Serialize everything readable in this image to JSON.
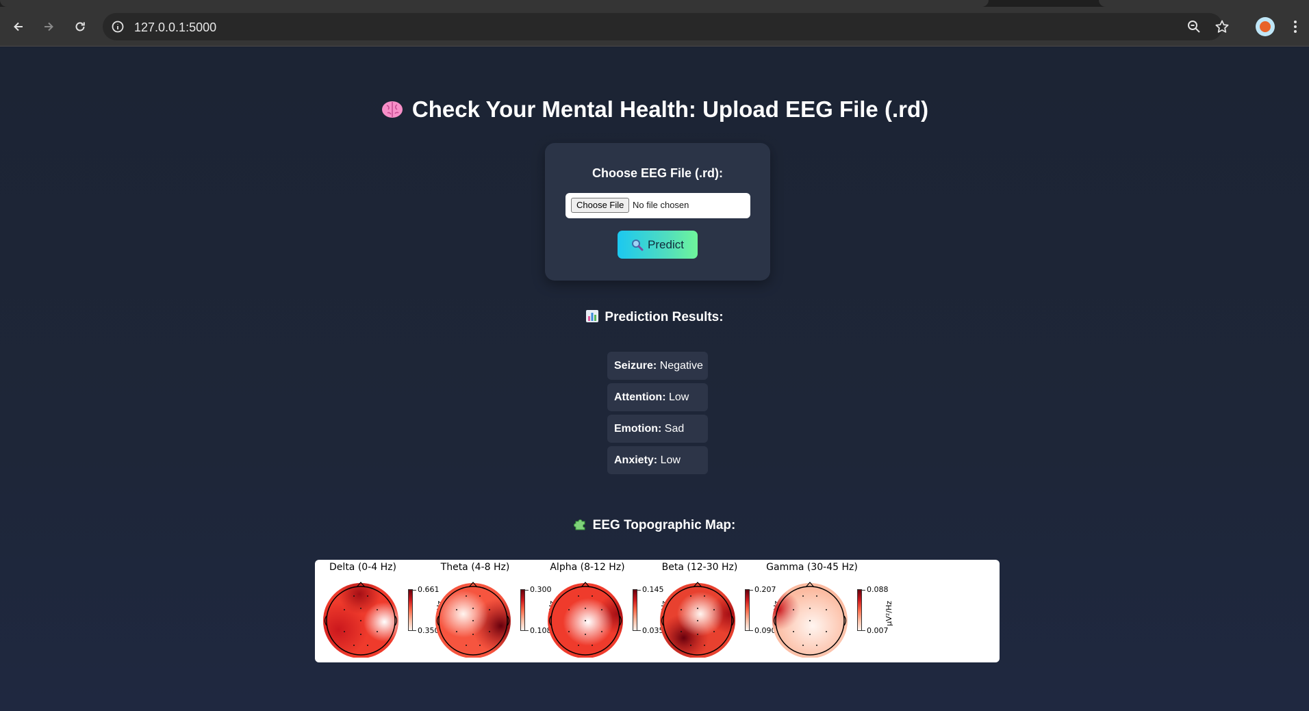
{
  "browser": {
    "url": "127.0.0.1:5000",
    "icons": [
      "back-arrow-icon",
      "forward-arrow-icon",
      "reload-icon",
      "site-info-icon",
      "zoom-icon",
      "bookmark-star-icon",
      "profile-avatar",
      "kebab-menu-icon"
    ]
  },
  "page": {
    "title": "Check Your Mental Health: Upload EEG File (.rd)",
    "title_icon": "brain-icon"
  },
  "upload": {
    "label": "Choose EEG File (.rd):",
    "choose_button": "Choose File",
    "file_status": "No file chosen",
    "predict_label": "Predict",
    "predict_icon": "magnifier-icon",
    "accent_from": "#1cc8f0",
    "accent_to": "#6ff59a"
  },
  "results": {
    "heading": "Prediction Results:",
    "heading_icon": "bar-chart-icon",
    "items": [
      {
        "key": "Seizure:",
        "value": "Negative"
      },
      {
        "key": "Attention:",
        "value": "Low"
      },
      {
        "key": "Emotion:",
        "value": "Sad"
      },
      {
        "key": "Anxiety:",
        "value": "Low"
      }
    ]
  },
  "topomap": {
    "heading": "EEG Topographic Map:",
    "heading_icon": "puzzle-piece-icon",
    "unit": "µV²/Hz",
    "colormap": [
      "#ffffff",
      "#fcbba1",
      "#fb6a4a",
      "#cb181d",
      "#67000d"
    ],
    "bands": [
      {
        "title": "Delta (0-4 Hz)",
        "max": "0.661",
        "min": "0.350"
      },
      {
        "title": "Theta (4-8 Hz)",
        "max": "0.300",
        "min": "0.108"
      },
      {
        "title": "Alpha (8-12 Hz)",
        "max": "0.145",
        "min": "0.035"
      },
      {
        "title": "Beta (12-30 Hz)",
        "max": "0.207",
        "min": "0.090"
      },
      {
        "title": "Gamma (30-45 Hz)",
        "max": "0.088",
        "min": "0.007"
      }
    ]
  }
}
